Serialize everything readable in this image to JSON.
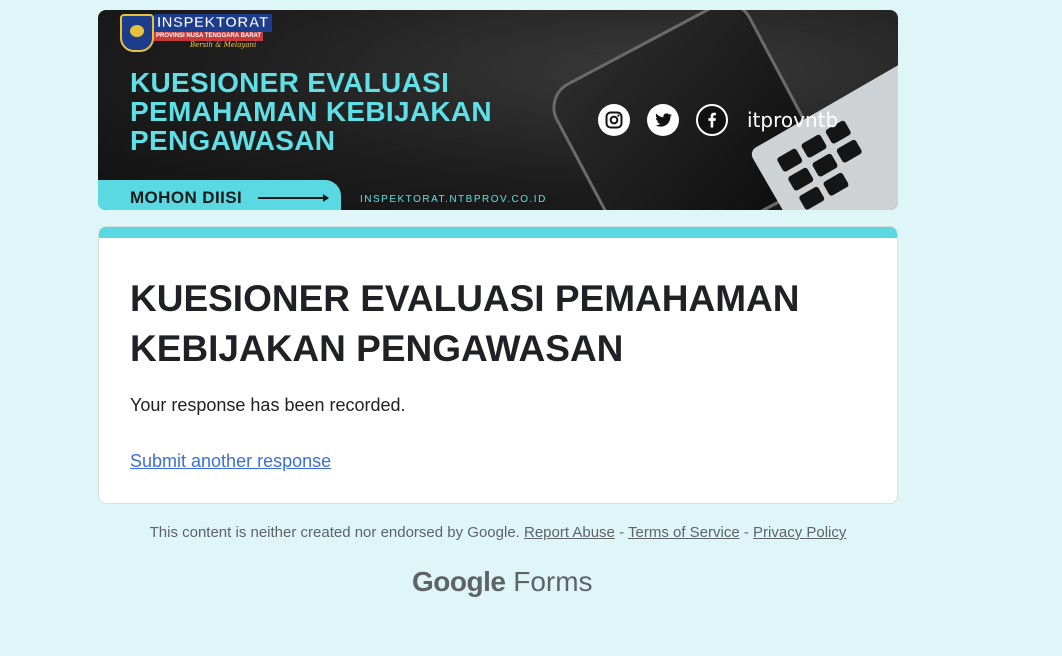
{
  "banner": {
    "logo_title": "INSPEKTORAT",
    "logo_subtitle": "PROVINSI NUSA TENGGARA BARAT",
    "logo_tagline": "Bersih & Melayani",
    "heading_lines": [
      "KUESIONER EVALUASI",
      "PEMAHAMAN KEBIJAKAN",
      "PENGAWASAN"
    ],
    "cta": "MOHON DIISI",
    "url": "INSPEKTORAT.NTBPROV.CO.ID",
    "social_handle": "itprovntb",
    "social_icons": [
      "instagram-icon",
      "twitter-icon",
      "facebook-icon"
    ],
    "accent_color": "#5ad9e2"
  },
  "card": {
    "title": "KUESIONER EVALUASI PEMAHAMAN KEBIJAKAN PENGAWASAN",
    "message": "Your response has been recorded.",
    "link": "Submit another response"
  },
  "footer": {
    "disclaimer": "This content is neither created nor endorsed by Google.",
    "report_abuse": "Report Abuse",
    "separator": "-",
    "terms": "Terms of Service",
    "privacy": "Privacy Policy"
  },
  "brand": {
    "google": "Google",
    "forms": "Forms"
  }
}
